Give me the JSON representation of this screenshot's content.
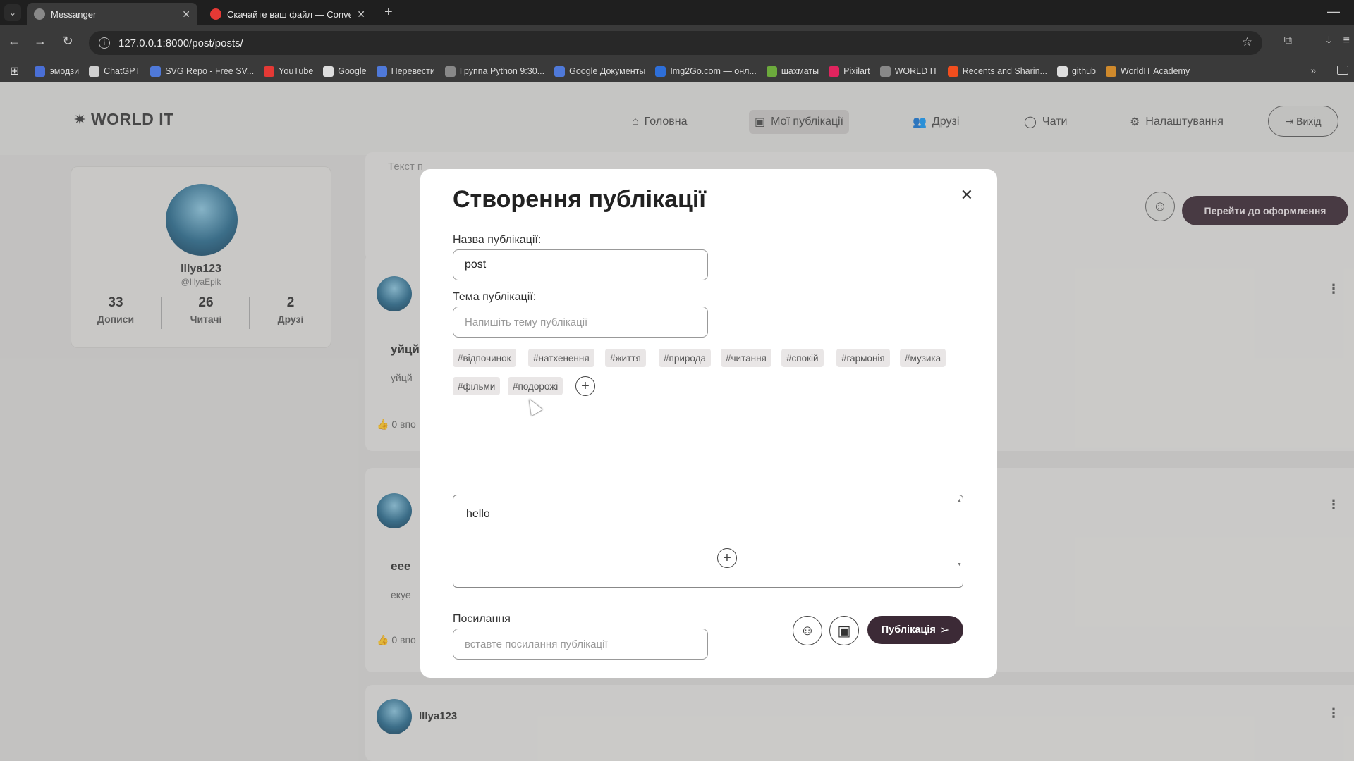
{
  "browser": {
    "tabs": [
      {
        "title": "Messanger",
        "active": true
      },
      {
        "title": "Скачайте ваш файл — Conver",
        "active": false
      }
    ],
    "url": "127.0.0.1:8000/post/posts/",
    "bookmarks": [
      {
        "label": "эмодзи",
        "color": "#4a6fd6"
      },
      {
        "label": "ChatGPT",
        "color": "#cfcfcf"
      },
      {
        "label": "SVG Repo - Free SV...",
        "color": "#4f79d9"
      },
      {
        "label": "YouTube",
        "color": "#e53935"
      },
      {
        "label": "Google",
        "color": "#dddddd"
      },
      {
        "label": "Перевести",
        "color": "#4f79d9"
      },
      {
        "label": "Группа Python 9:30...",
        "color": "#888888"
      },
      {
        "label": "Google Документы",
        "color": "#4f79d9"
      },
      {
        "label": "Img2Go.com — онл...",
        "color": "#2e6fd9"
      },
      {
        "label": "шахматы",
        "color": "#6caa3c"
      },
      {
        "label": "Pixilart",
        "color": "#e0245e"
      },
      {
        "label": "WORLD IT",
        "color": "#888888"
      },
      {
        "label": "Recents and Sharin...",
        "color": "#f24e1e"
      },
      {
        "label": "github",
        "color": "#dddddd"
      },
      {
        "label": "WorldIT Academy",
        "color": "#d08a2c"
      }
    ]
  },
  "header": {
    "logo": "WORLD IT",
    "nav": [
      {
        "label": "Головна",
        "icon": "home-icon"
      },
      {
        "label": "Мої публікації",
        "icon": "image-icon",
        "active": true
      },
      {
        "label": "Друзі",
        "icon": "users-icon"
      },
      {
        "label": "Чати",
        "icon": "chat-icon"
      },
      {
        "label": "Налаштування",
        "icon": "gear-icon"
      }
    ],
    "exit_label": "Вихід"
  },
  "profile": {
    "name": "Illya123",
    "handle": "@IllyaEpik",
    "stats": [
      {
        "value": "33",
        "label": "Дописи"
      },
      {
        "value": "26",
        "label": "Читачі"
      },
      {
        "value": "2",
        "label": "Друзі"
      }
    ]
  },
  "composer": {
    "placeholder_fragment": "Текст п",
    "goto_label": "Перейти до оформлення"
  },
  "posts": [
    {
      "title_fragment": "уйцй",
      "text_fragment": "уйцй",
      "likes_fragment": "0 впо",
      "author_fragment": "I"
    },
    {
      "title_fragment": "еее",
      "text_fragment": "екуе",
      "likes_fragment": "0 впо",
      "author_fragment": "I"
    },
    {
      "author": "Illya123"
    }
  ],
  "modal": {
    "title": "Створення публікації",
    "name_label": "Назва публікації:",
    "name_value": "post",
    "topic_label": "Тема публікації:",
    "topic_placeholder": "Напишіть тему публікації",
    "tags": [
      "#відпочинок",
      "#натхенення",
      "#життя",
      "#природа",
      "#читання",
      "#спокій",
      "#гармонія",
      "#музика",
      "#фільми",
      "#подорожі"
    ],
    "body_text": "hello",
    "link_label": "Посилання",
    "link_placeholder": "вставте посилання публікації",
    "publish_label": "Публікація"
  }
}
